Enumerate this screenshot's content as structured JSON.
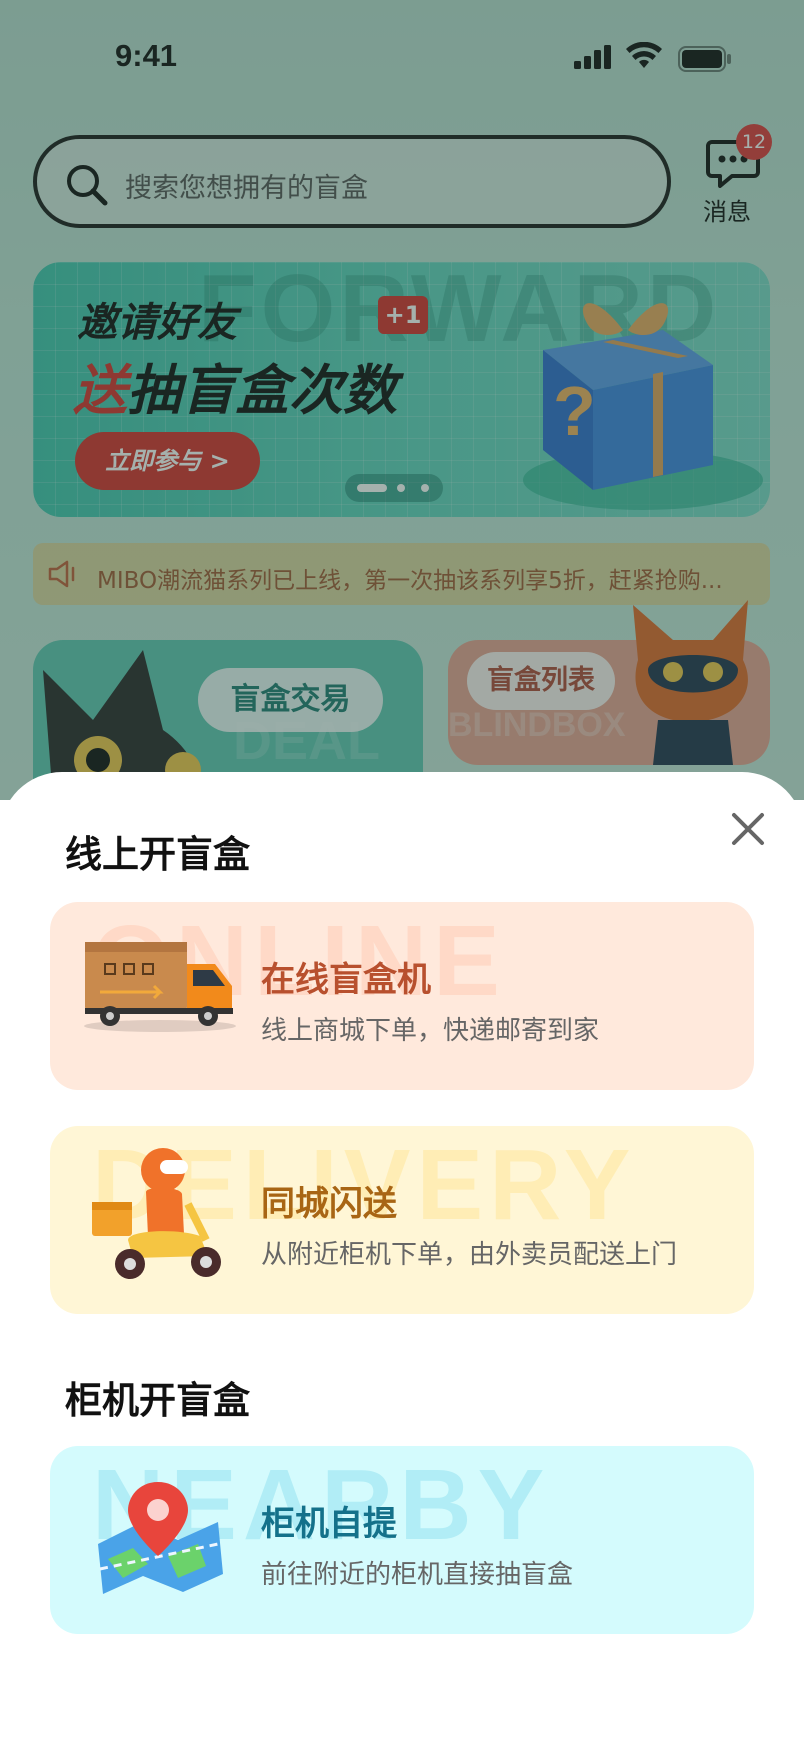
{
  "status": {
    "time": "9:41"
  },
  "search": {
    "placeholder": "搜索您想拥有的盲盒"
  },
  "messages": {
    "badge": "12",
    "label": "消息"
  },
  "banner": {
    "watermark": "FORWARD",
    "line1": "邀请好友",
    "line2_red": "送",
    "line2": "抽盲盒次数",
    "plus": "+1",
    "cta": "立即参与 >"
  },
  "notice": {
    "text": "MIBO潮流猫系列已上线，第一次抽该系列享5折，赶紧抢购..."
  },
  "entries": {
    "trade": "盲盒交易",
    "trade_wm": "DEAL",
    "list": "盲盒列表",
    "list_wm": "BLINDBOX"
  },
  "sheet": {
    "section1": "线上开盲盒",
    "section2": "柜机开盲盒",
    "options": [
      {
        "watermark": "ONLINE",
        "title": "在线盲盒机",
        "subtitle": "线上商城下单，快递邮寄到家",
        "icon": "delivery-truck-icon"
      },
      {
        "watermark": "DELIVERY",
        "title": "同城闪送",
        "subtitle": "从附近柜机下单，由外卖员配送上门",
        "icon": "scooter-courier-icon"
      },
      {
        "watermark": "NEARBY",
        "title": "柜机自提",
        "subtitle": "前往附近的柜机直接抽盲盒",
        "icon": "map-pin-icon"
      }
    ]
  },
  "colors": {
    "accent_red": "#d8312b",
    "banner_teal": "#41c5ae",
    "online_bg": "#ffe9dc",
    "delivery_bg": "#fff6d6",
    "nearby_bg": "#d4fbfd"
  }
}
